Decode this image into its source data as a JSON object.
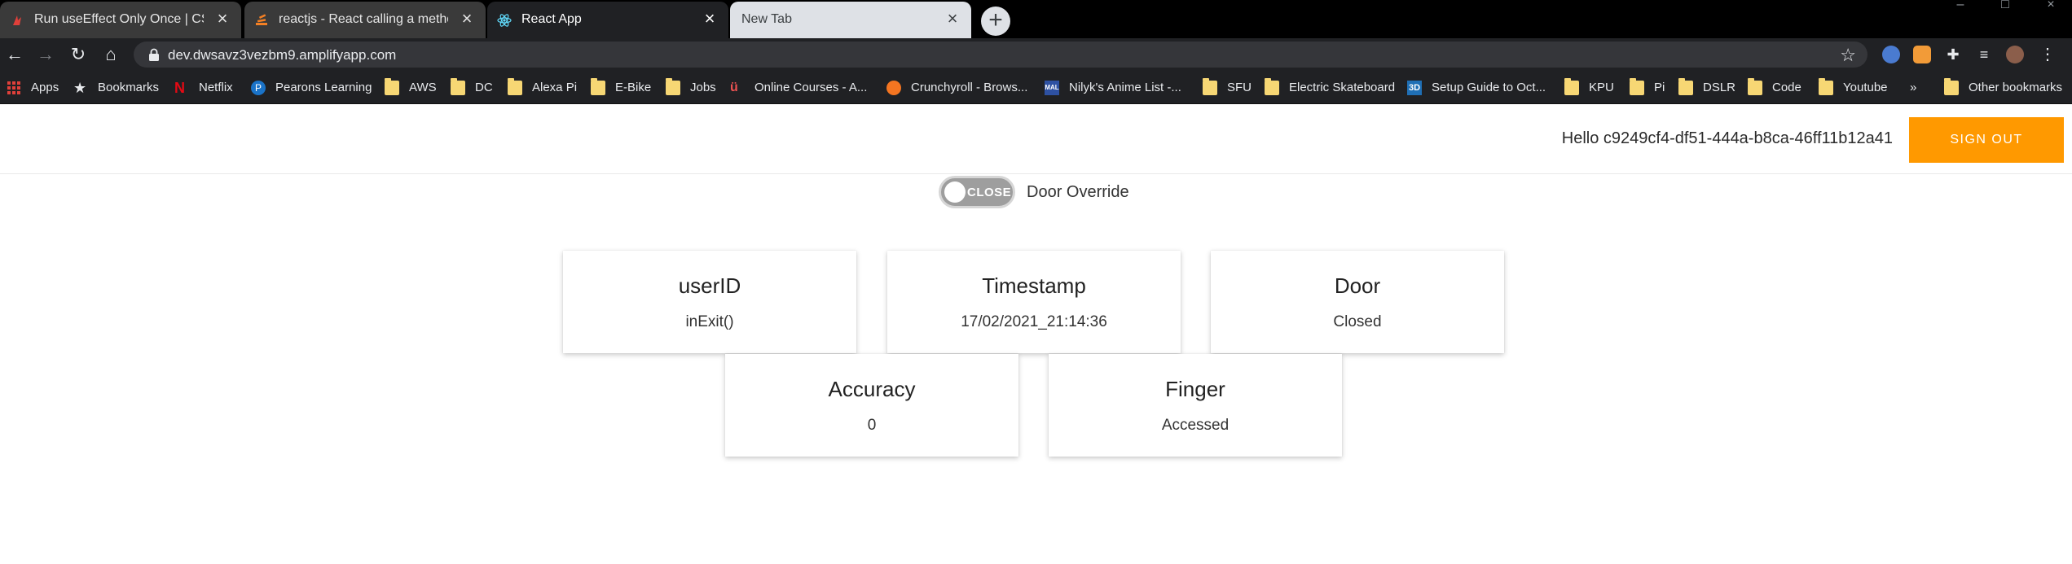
{
  "browser": {
    "tabs": [
      {
        "title": "Run useEffect Only Once | CSS-Tricks",
        "state": "inactive",
        "favicon": "css-tricks-icon"
      },
      {
        "title": "reactjs - React calling a method on load",
        "state": "inactive",
        "favicon": "stackoverflow-icon"
      },
      {
        "title": "React App",
        "state": "active",
        "favicon": "react-icon"
      },
      {
        "title": "New Tab",
        "state": "light",
        "favicon": ""
      }
    ],
    "new_tab_symbol": "+",
    "url": "dev.dwsavz3vezbm9.amplifyapp.com",
    "bookmarks": [
      {
        "label": "Apps",
        "icon": "apps-grid-icon"
      },
      {
        "label": "Bookmarks",
        "icon": "star-icon"
      },
      {
        "label": "Netflix",
        "icon": "netflix-icon"
      },
      {
        "label": "Pearons Learning",
        "icon": "pearson-icon"
      },
      {
        "label": "AWS",
        "icon": "folder-icon"
      },
      {
        "label": "DC",
        "icon": "folder-icon"
      },
      {
        "label": "Alexa Pi",
        "icon": "folder-icon"
      },
      {
        "label": "E-Bike",
        "icon": "folder-icon"
      },
      {
        "label": "Jobs",
        "icon": "folder-icon"
      },
      {
        "label": "Online Courses - A...",
        "icon": "udemy-icon"
      },
      {
        "label": "Crunchyroll - Brows...",
        "icon": "crunchyroll-icon"
      },
      {
        "label": "Nilyk's Anime List -...",
        "icon": "mal-icon"
      },
      {
        "label": "SFU",
        "icon": "folder-icon"
      },
      {
        "label": "Electric Skateboard",
        "icon": "folder-icon"
      },
      {
        "label": "Setup Guide to Oct...",
        "icon": "octoprint-icon"
      },
      {
        "label": "KPU",
        "icon": "folder-icon"
      },
      {
        "label": "Pi",
        "icon": "folder-icon"
      },
      {
        "label": "DSLR",
        "icon": "folder-icon"
      },
      {
        "label": "Code",
        "icon": "folder-icon"
      },
      {
        "label": "Youtube",
        "icon": "folder-icon"
      }
    ],
    "overflow_label": "»",
    "other_bookmarks": "Other bookmarks"
  },
  "app": {
    "greeting": "Hello c9249cf4-df51-444a-b8ca-46ff11b12a41",
    "sign_out": "SIGN OUT",
    "toggle_state": "CLOSE",
    "toggle_label": "Door Override",
    "cards": [
      {
        "label": "userID",
        "value": "inExit()"
      },
      {
        "label": "Timestamp",
        "value": "17/02/2021_21:14:36"
      },
      {
        "label": "Door",
        "value": "Closed"
      },
      {
        "label": "Accuracy",
        "value": "0"
      },
      {
        "label": "Finger",
        "value": "Accessed"
      }
    ]
  },
  "colors": {
    "accent": "#ff9900",
    "chrome_dark": "#202124",
    "toggle_off": "#9e9e9e"
  }
}
